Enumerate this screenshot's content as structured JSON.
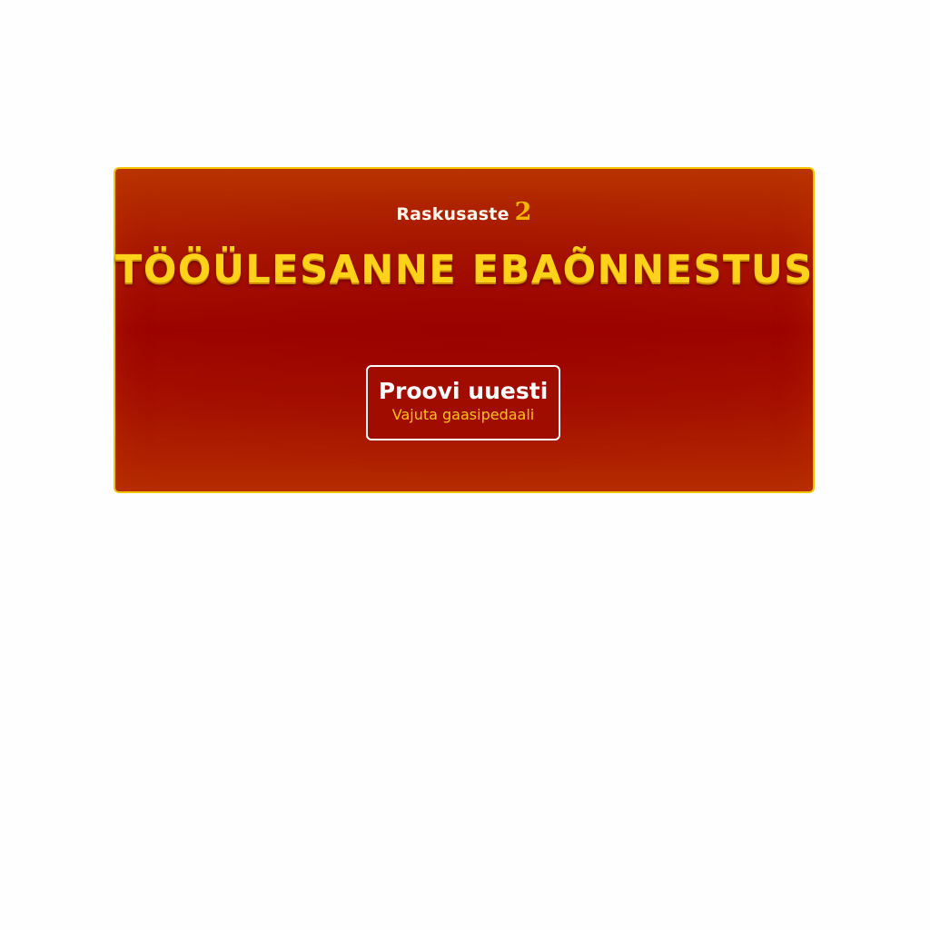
{
  "dialog": {
    "difficulty_label": "Raskusaste",
    "difficulty_value": "2",
    "title": "TÖÖÜLESANNE EBAÕNNESTUS",
    "retry_label": "Proovi uuesti",
    "retry_hint": "Vajuta gaasipedaali"
  },
  "colors": {
    "panel_background": "#a30a00",
    "panel_border": "#f5c400",
    "title_text": "#ffd21a",
    "hint_text": "#ffc21a",
    "difficulty_value": "#f5b400"
  }
}
